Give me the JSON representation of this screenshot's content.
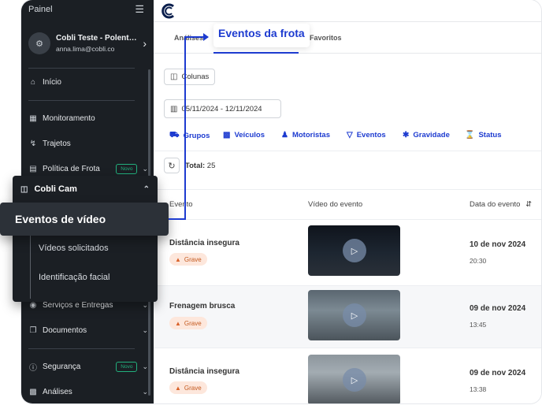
{
  "sidebar": {
    "title": "Painel",
    "account": {
      "name": "Cobli Teste - Polentas ...",
      "email": "anna.lima@cobli.co"
    },
    "items": [
      {
        "id": "inicio",
        "label": "Início",
        "icon": "home-icon"
      },
      {
        "id": "monitoramento",
        "label": "Monitoramento",
        "icon": "map-icon"
      },
      {
        "id": "trajetos",
        "label": "Trajetos",
        "icon": "route-icon"
      },
      {
        "id": "politica",
        "label": "Política de Frota",
        "icon": "document-icon",
        "badge": "Novo"
      },
      {
        "id": "servicos",
        "label": "Serviços e Entregas",
        "icon": "package-icon"
      },
      {
        "id": "documentos",
        "label": "Documentos",
        "icon": "documents-icon"
      },
      {
        "id": "seguranca",
        "label": "Segurança",
        "icon": "shield-icon",
        "badge": "Novo"
      },
      {
        "id": "analises",
        "label": "Análises",
        "icon": "chart-icon"
      }
    ],
    "cobli_cam": {
      "label": "Cobli Cam",
      "active_item": "Eventos de vídeo",
      "sub_items": [
        "Vídeos solicitados",
        "Identificação facial"
      ]
    }
  },
  "tabs": {
    "analises": "Análises",
    "active": "Eventos da frota",
    "favoritos": "Favoritos"
  },
  "toolbar": {
    "columns_label": "Colunas",
    "date_range": "05/11/2024 - 12/11/2024"
  },
  "filters": [
    {
      "label": "Grupos",
      "icon": "truck-icon"
    },
    {
      "label": "Veículos",
      "icon": "car-icon"
    },
    {
      "label": "Motoristas",
      "icon": "person-icon"
    },
    {
      "label": "Eventos",
      "icon": "filter-icon"
    },
    {
      "label": "Gravidade",
      "icon": "bolt-icon"
    },
    {
      "label": "Status",
      "icon": "hourglass-icon"
    }
  ],
  "total": {
    "label": "Total:",
    "value": "25"
  },
  "table": {
    "headers": {
      "event": "Evento",
      "video": "Vídeo do evento",
      "date": "Data do evento"
    },
    "rows": [
      {
        "event": "Distância insegura",
        "severity": "Grave",
        "date": "10 de nov 2024",
        "time": "20:30"
      },
      {
        "event": "Frenagem brusca",
        "severity": "Grave",
        "date": "09 de nov 2024",
        "time": "13:45"
      },
      {
        "event": "Distância insegura",
        "severity": "Grave",
        "date": "09 de nov 2024",
        "time": "13:38"
      }
    ]
  },
  "colors": {
    "accent": "#1d3bd0",
    "sidebar_bg": "#1b1f24",
    "new_badge": "#22b07d",
    "severity_bg": "#fde7dc",
    "severity_text": "#c45a1f"
  }
}
